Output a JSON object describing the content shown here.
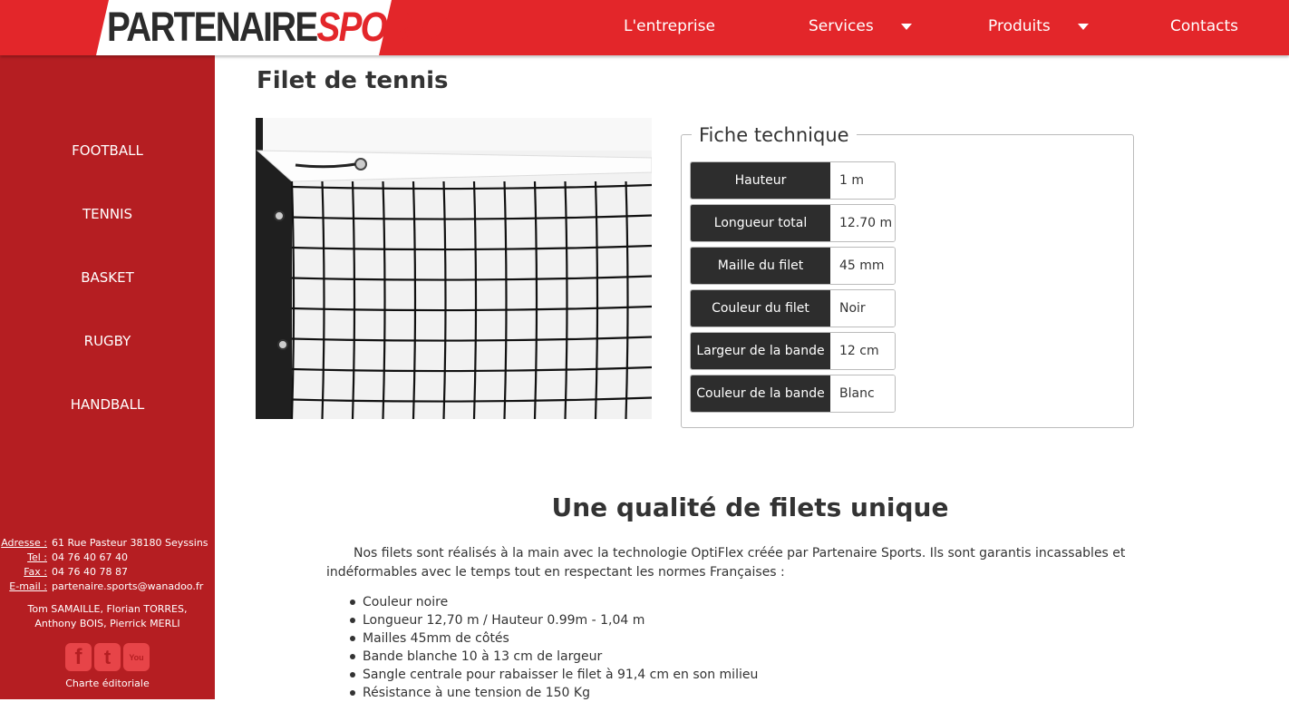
{
  "header": {
    "logo_part1": "PARTENAIRE",
    "logo_part2": "SPORTS",
    "nav": [
      {
        "label": "L'entreprise"
      },
      {
        "label": "Services"
      },
      {
        "label": "Produits"
      },
      {
        "label": "Contacts"
      }
    ]
  },
  "sidebar": {
    "items": [
      {
        "label": "FOOTBALL"
      },
      {
        "label": "TENNIS"
      },
      {
        "label": "BASKET"
      },
      {
        "label": "RUGBY"
      },
      {
        "label": "HANDBALL"
      }
    ],
    "contact": {
      "address_label": "Adresse :",
      "address": "61 Rue Pasteur 38180 Seyssins",
      "tel_label": "Tel :",
      "tel": "04 76 40 67 40",
      "fax_label": "Fax :",
      "fax": "04 76 40 78 87",
      "email_label": "E-mail :",
      "email": "partenaire.sports@wanadoo.fr"
    },
    "credits": "Tom SAMAILLE, Florian TORRES, Anthony BOIS, Pierrick MERLI",
    "socials": [
      {
        "icon": "facebook-icon",
        "glyph": "f"
      },
      {
        "icon": "twitter-icon",
        "glyph": "t"
      },
      {
        "icon": "youtube-icon",
        "glyph": "You"
      }
    ],
    "charte": "Charte éditoriale"
  },
  "main": {
    "title": "Filet de tennis",
    "fiche": {
      "legend": "Fiche technique",
      "rows": [
        {
          "key": "Hauteur",
          "value": "1 m"
        },
        {
          "key": "Longueur total",
          "value": "12.70 m"
        },
        {
          "key": "Maille du filet",
          "value": "45 mm"
        },
        {
          "key": "Couleur du filet",
          "value": "Noir"
        },
        {
          "key": "Largeur de la bande",
          "value": "12 cm"
        },
        {
          "key": "Couleur de la bande",
          "value": "Blanc"
        }
      ]
    },
    "section_title": "Une qualité de filets unique",
    "intro": "Nos filets sont réalisés à la main avec la technologie OptiFlex créée par Partenaire Sports. Ils sont garantis incassables et indéformables avec le temps tout en respectant les normes Françaises :",
    "bullets": [
      "Couleur noire",
      "Longueur 12,70 m / Hauteur 0.99m - 1,04 m",
      "Mailles 45mm de côtés",
      "Bande blanche 10 à 13 cm de largeur",
      "Sangle centrale pour rabaisser le filet à 91,4 cm en son milieu",
      "Résistance à une tension de 150 Kg"
    ]
  },
  "colors": {
    "header_red": "#e3262a",
    "sidebar_red": "#b51e22",
    "dark": "#2d2d2d"
  }
}
